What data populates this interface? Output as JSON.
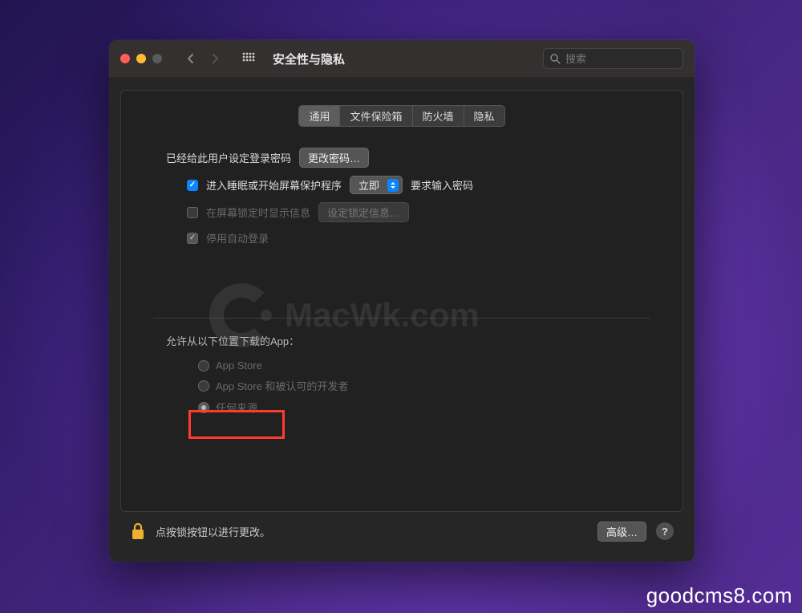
{
  "window_title": "安全性与隐私",
  "search": {
    "placeholder": "搜索"
  },
  "tabs": [
    "通用",
    "文件保险箱",
    "防火墙",
    "隐私"
  ],
  "section1": {
    "password_set_text": "已经给此用户设定登录密码",
    "change_password_btn": "更改密码…",
    "require_password_label": "进入睡眠或开始屏幕保护程序",
    "require_select_value": "立即",
    "require_suffix": "要求输入密码",
    "show_lock_message_label": "在屏幕锁定时显示信息",
    "set_lock_message_btn": "设定锁定信息…",
    "disable_auto_login": "停用自动登录"
  },
  "watermark_text": "MacWk.com",
  "section2": {
    "title": "允许从以下位置下载的App：",
    "options": [
      "App Store",
      "App Store 和被认可的开发者",
      "任何来源"
    ]
  },
  "footer": {
    "lock_text": "点按锁按钮以进行更改。",
    "advanced_btn": "高级…"
  },
  "credit": "goodcms8.com"
}
